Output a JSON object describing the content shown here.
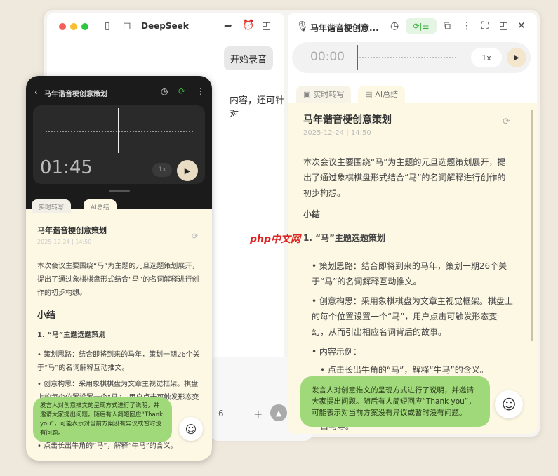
{
  "left_window": {
    "app_name": "DeepSeek",
    "record_button": "开始录音",
    "partial_text": "内容，还可针对",
    "input_partial": "6"
  },
  "right_panel": {
    "title": "马年谐音梗创意...",
    "player": {
      "time": "00:00",
      "speed": "1x"
    },
    "tabs": [
      {
        "label": "实时转写"
      },
      {
        "label": "AI总结"
      }
    ],
    "summary": {
      "title": "马年谐音梗创意策划",
      "date": "2025-12-24",
      "time": "14:50",
      "intro": "本次会议主要围绕“马”为主题的元旦选题策划展开，提出了通过象棋棋盘形式结合“马”的名词解释进行创作的初步构想。",
      "section": "小结",
      "subsection": "1. “马”主题选题策划",
      "bullets": [
        "策划思路：结合即将到来的马年，策划一期26个关于“马”的名词解释互动推文。",
        "创意构思：采用象棋棋盘为文章主视觉框架。棋盘上的每个位置设置一个“马”，用户点击可触发形态变幻，从而引出相应名词背后的故事。",
        "内容示例："
      ],
      "sub_bullet": "点击长出牛角的“马”，解释“牛马”的含义。",
      "tail": "白马等。"
    },
    "bubble": "发言人对创意推文的呈现方式进行了说明，并邀请大家提出问题。随后有人简短回应“Thank you”，可能表示对当前方案没有异议或暂时没有问题。"
  },
  "phone": {
    "title": "马年谐音梗创意策划",
    "player": {
      "time": "01:45",
      "speed": "1x"
    },
    "tabs": [
      {
        "label": "实时转写"
      },
      {
        "label": "AI总结"
      }
    ],
    "last_bullet": "点击长出牛角的“马”，解释“牛马”的含义。"
  },
  "watermark": "php中文网",
  "colors": {
    "accent_green": "#3cb043",
    "cream": "#fdf8e4",
    "bubble": "#9fd97a"
  }
}
